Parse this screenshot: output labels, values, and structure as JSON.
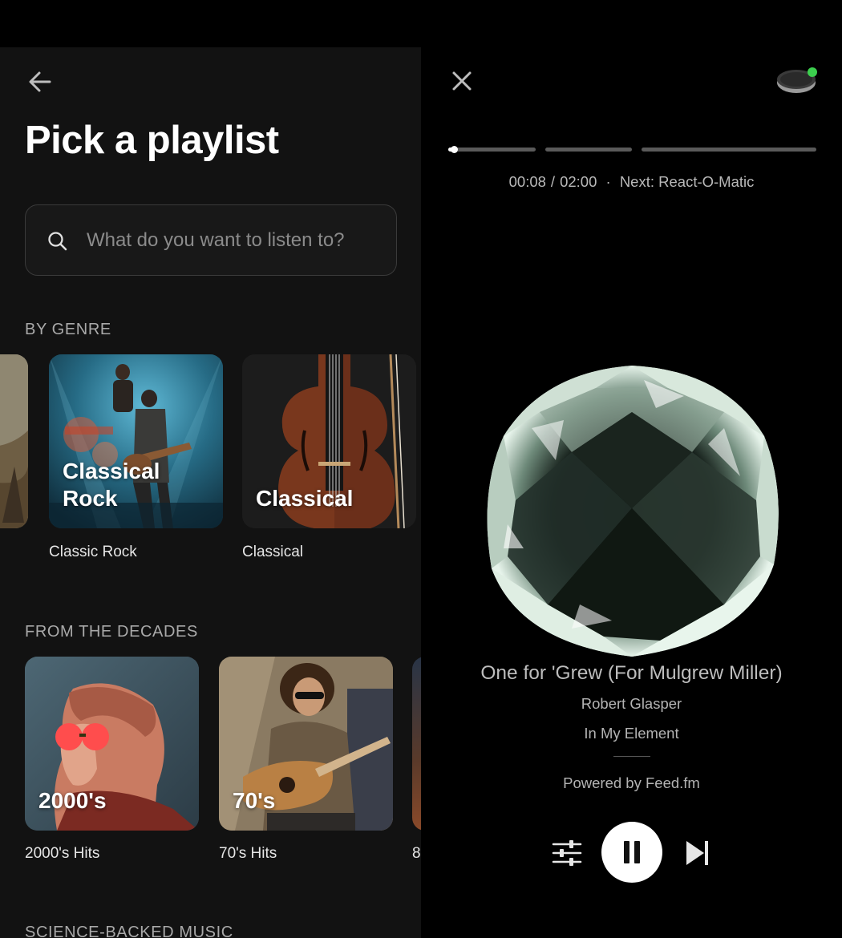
{
  "playlist_screen": {
    "title": "Pick a playlist",
    "search": {
      "placeholder": "What do you want to listen to?",
      "value": ""
    },
    "sections": {
      "genre": {
        "heading": "BY GENRE",
        "cards": [
          {
            "overlay": "",
            "caption": ""
          },
          {
            "overlay_lines": [
              "Classical",
              "Rock"
            ],
            "caption": "Classic Rock"
          },
          {
            "overlay": "Classical",
            "caption": "Classical"
          }
        ]
      },
      "decades": {
        "heading": "FROM THE DECADES",
        "cards": [
          {
            "overlay": "2000's",
            "caption": "2000's Hits"
          },
          {
            "overlay": "70's",
            "caption": "70's Hits"
          },
          {
            "overlay": "",
            "caption": "8"
          }
        ]
      },
      "science": {
        "heading": "SCIENCE-BACKED MUSIC"
      }
    }
  },
  "player_screen": {
    "progress": {
      "elapsed": "00:08",
      "total": "02:00",
      "fraction": 0.067
    },
    "separator": "/",
    "dot": "·",
    "next_label": "Next: React-O-Matic",
    "song_title": "One for 'Grew (For Mulgrew Miller)",
    "artist": "Robert Glasper",
    "album": "In My Element",
    "powered_by": "Powered by Feed.fm",
    "device_status_color": "#3ccf4e"
  },
  "icons": {
    "back": "arrow-left-icon",
    "search": "search-icon",
    "close": "close-icon",
    "device": "speaker-device-icon",
    "equalizer": "equalizer-sliders-icon",
    "pause": "pause-icon",
    "next": "skip-next-icon"
  }
}
